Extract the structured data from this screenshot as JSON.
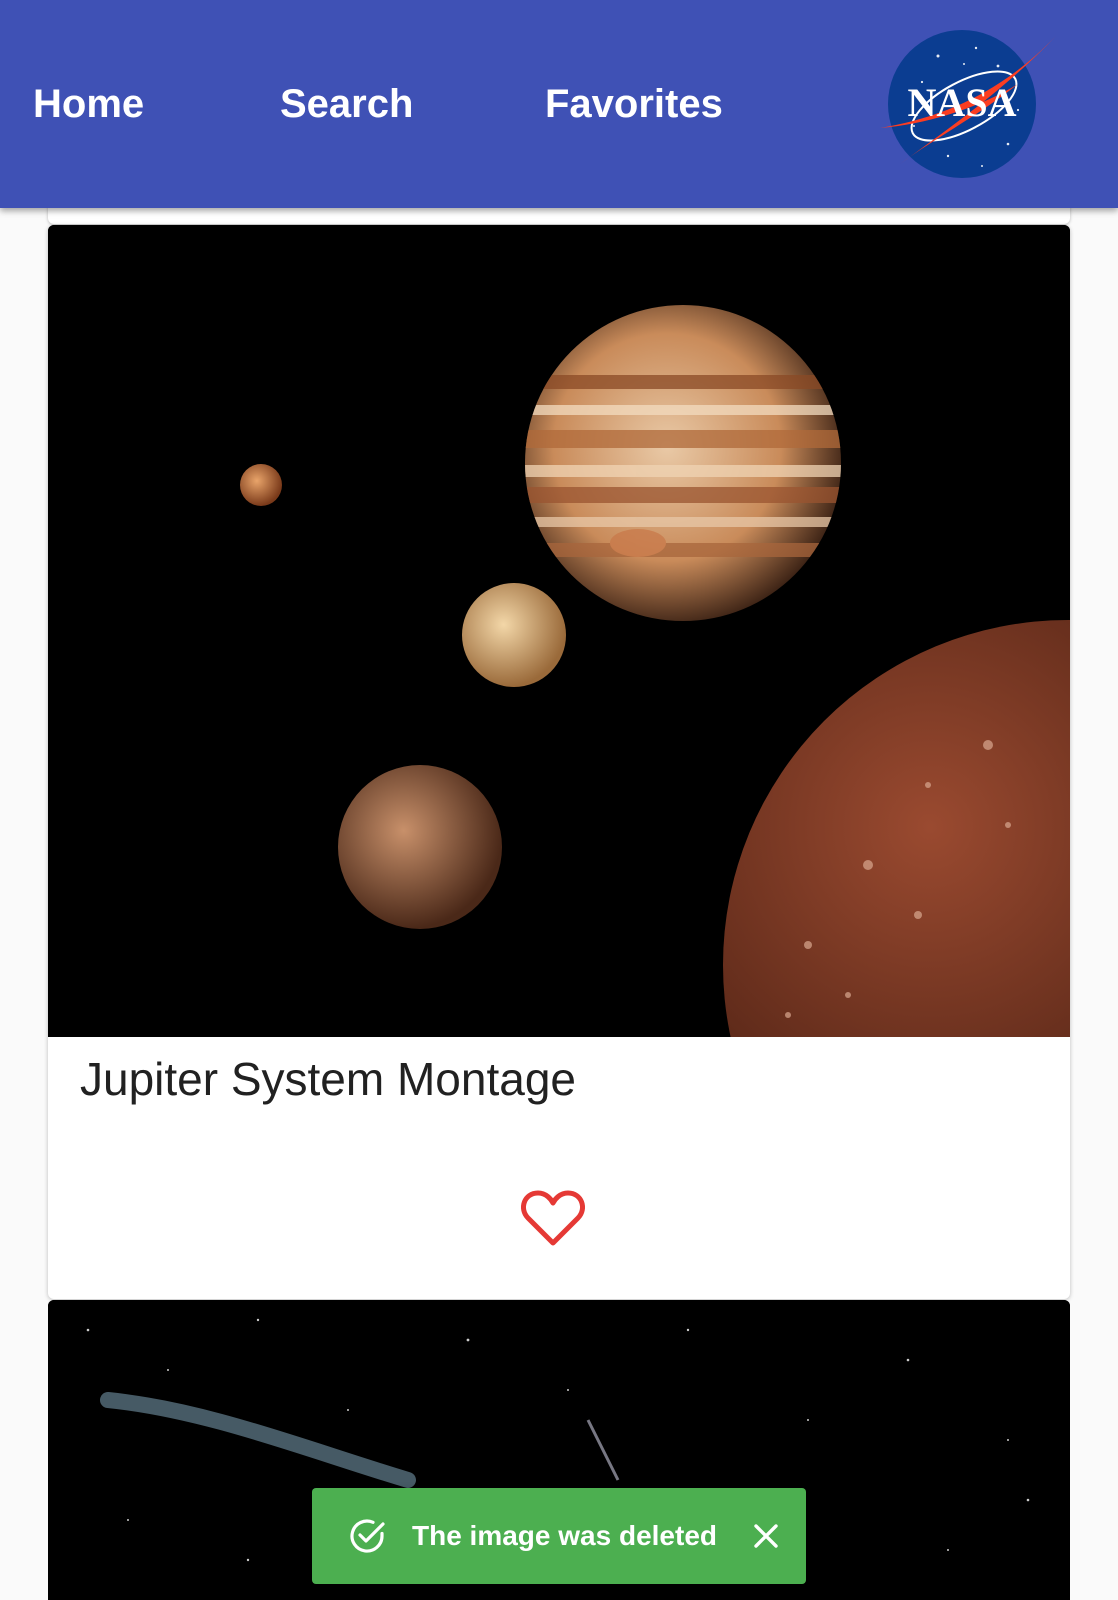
{
  "nav": {
    "home_label": "Home",
    "search_label": "Search",
    "favorites_label": "Favorites",
    "logo_text": "NASA"
  },
  "card": {
    "title": "Jupiter System Montage",
    "favorite_icon": "heart-outline-icon"
  },
  "snackbar": {
    "message": "The image was deleted",
    "status_icon": "check-circle-icon",
    "close_icon": "close-icon"
  },
  "colors": {
    "header": "#3f51b5",
    "snackbar": "#4caf50",
    "favorite": "#e53935"
  }
}
